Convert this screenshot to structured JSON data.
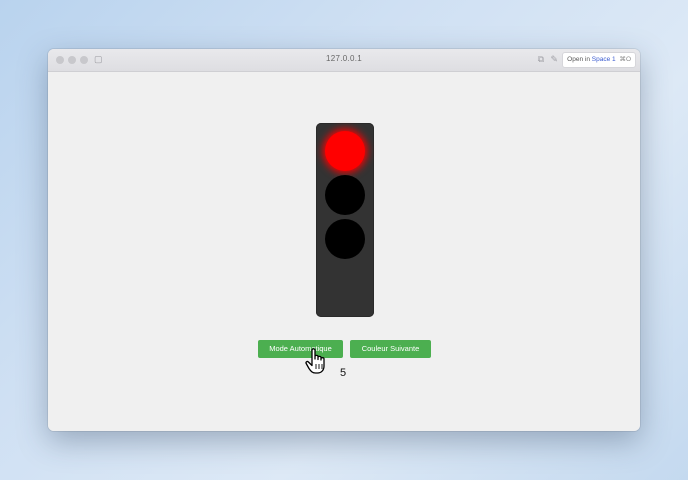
{
  "browser": {
    "url": "127.0.0.1",
    "open_in_label": "Open in",
    "open_in_space": "Space 1",
    "open_in_shortcut": "⌘O"
  },
  "traffic_light": {
    "lights": [
      {
        "name": "red",
        "state": "on",
        "color": "#ff0000"
      },
      {
        "name": "yellow",
        "state": "off",
        "color": "#000000"
      },
      {
        "name": "green",
        "state": "off",
        "color": "#000000"
      }
    ],
    "housing_color": "#333333"
  },
  "controls": {
    "auto_mode_label": "Mode Automatique",
    "next_color_label": "Couleur Suivante",
    "button_color": "#4caf50"
  },
  "counter": "5"
}
